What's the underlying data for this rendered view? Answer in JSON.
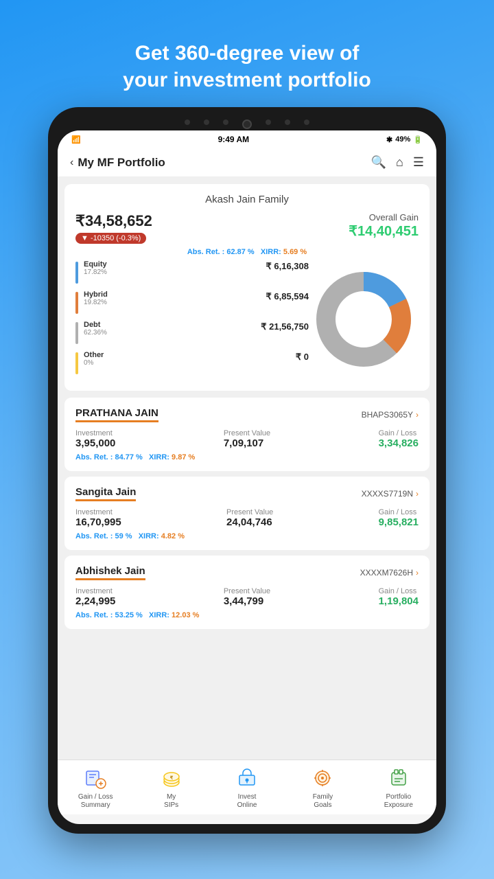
{
  "page": {
    "header": {
      "line1": "Get 360-degree view of",
      "line2": "your investment portfolio"
    },
    "status_bar": {
      "time": "9:49 AM",
      "battery": "49%",
      "bluetooth": "BT"
    },
    "top_bar": {
      "back_label": "My MF Portfolio"
    },
    "portfolio": {
      "family_name": "Akash Jain Family",
      "total_amount": "₹34,58,652",
      "change": "▼ -10350  (-0.3%)",
      "overall_gain_label": "Overall Gain",
      "overall_gain": "₹14,40,451",
      "abs_ret_label": "Abs. Ret. :",
      "abs_ret_value": "62.87 %",
      "xirr_label": "XIRR:",
      "xirr_value": "5.69 %",
      "allocations": [
        {
          "label": "Equity",
          "pct": "17.82%",
          "value": "₹ 6,16,308",
          "color": "#4e9bde"
        },
        {
          "label": "Hybrid",
          "pct": "19.82%",
          "value": "₹ 6,85,594",
          "color": "#e07e3c"
        },
        {
          "label": "Debt",
          "pct": "62.36%",
          "value": "₹ 21,56,750",
          "color": "#b0b0b0"
        },
        {
          "label": "Other",
          "pct": "0%",
          "value": "₹ 0",
          "color": "#f5c842"
        }
      ],
      "donut": {
        "equity_pct": 17.82,
        "hybrid_pct": 19.82,
        "debt_pct": 62.36,
        "other_pct": 0
      }
    },
    "members": [
      {
        "name": "PRATHANA JAIN",
        "id": "BHAPS3065Y",
        "investment": "3,95,000",
        "present_value": "7,09,107",
        "gain_loss": "3,34,826",
        "abs_ret": "84.77 %",
        "xirr": "9.87 %"
      },
      {
        "name": "Sangita Jain",
        "id": "XXXXS7719N",
        "investment": "16,70,995",
        "present_value": "24,04,746",
        "gain_loss": "9,85,821",
        "abs_ret": "59 %",
        "xirr": "4.82 %"
      },
      {
        "name": "Abhishek Jain",
        "id": "XXXXM7626H",
        "investment": "2,24,995",
        "present_value": "3,44,799",
        "gain_loss": "1,19,804",
        "abs_ret": "53.25 %",
        "xirr": "12.03 %"
      }
    ],
    "bottom_nav": [
      {
        "label": "Gain / Loss\nSummary",
        "icon": "chart"
      },
      {
        "label": "My\nSIPs",
        "icon": "sip"
      },
      {
        "label": "Invest\nOnline",
        "icon": "cart"
      },
      {
        "label": "Family\nGoals",
        "icon": "target"
      },
      {
        "label": "Portfolio\nExposure",
        "icon": "bag"
      }
    ],
    "labels": {
      "investment": "Investment",
      "present_value": "Present Value",
      "gain_loss": "Gain / Loss",
      "abs_ret": "Abs. Ret. :",
      "xirr": "XIRR:"
    }
  }
}
